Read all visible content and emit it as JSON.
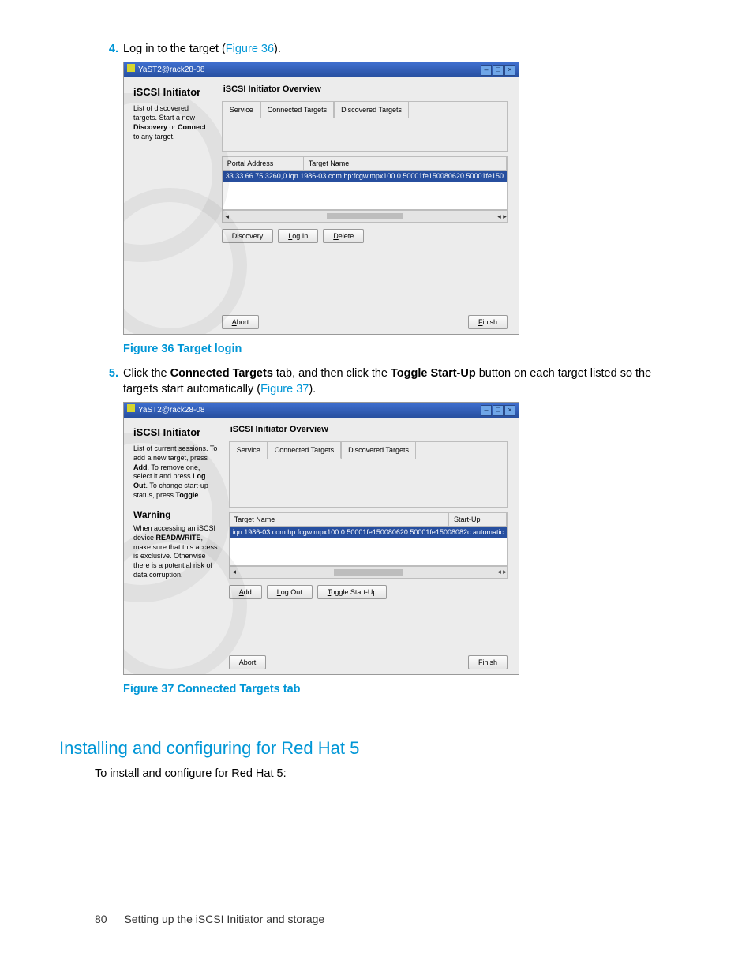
{
  "steps": {
    "s4": {
      "num": "4.",
      "text_a": "Log in to the target (",
      "link": "Figure 36",
      "text_b": ")."
    },
    "s5": {
      "num": "5.",
      "text_a": "Click the ",
      "bold1": "Connected Targets",
      "text_b": " tab, and then click the ",
      "bold2": "Toggle Start-Up",
      "text_c": " button on each target listed so the targets start automatically (",
      "link": "Figure 37",
      "text_d": ")."
    }
  },
  "figs": {
    "f36": "Figure 36 Target login",
    "f37": "Figure 37 Connected Targets tab"
  },
  "section": {
    "heading": "Installing and configuring for Red Hat 5",
    "intro": "To install and configure for Red Hat 5:"
  },
  "footer": {
    "page": "80",
    "chapter": "Setting up the iSCSI Initiator and storage"
  },
  "win1": {
    "title": "YaST2@rack28-08",
    "left_title": "iSCSI Initiator",
    "left_p1a": "List of discovered targets. Start a new ",
    "left_p1_b1": "Discovery",
    "left_p1b": " or ",
    "left_p1_b2": "Connect",
    "left_p1c": " to any target.",
    "right_title": "iSCSI Initiator Overview",
    "tabs": {
      "service": "Service",
      "connected": "Connected Targets",
      "discovered": "Discovered Targets"
    },
    "cols": {
      "portal": "Portal Address",
      "target": "Target Name"
    },
    "row": "33.33.66.75:3260,0 iqn.1986-03.com.hp:fcgw.mpx100.0.50001fe150080620.50001fe150",
    "btns": {
      "discovery": "Discovery",
      "login": "Log In",
      "delete": "Delete",
      "abort": "Abort",
      "finish": "Finish"
    },
    "underline": {
      "login": "L",
      "delete": "D",
      "abort": "A",
      "finish": "F"
    }
  },
  "win2": {
    "title": "YaST2@rack28-08",
    "left_title": "iSCSI Initiator",
    "left_p1a": "List of current sessions. To add a new target, press ",
    "b_add": "Add",
    "left_p1b": ". To remove one, select it and press ",
    "b_logout": "Log Out",
    "left_p1c": ". To change start-up status, press ",
    "b_toggle": "Toggle",
    "left_p1d": ".",
    "warn_h": "Warning",
    "warn_a": "When accessing an iSCSI device ",
    "warn_b": "READ/WRITE",
    "warn_c": ", make sure that this access is exclusive. Otherwise there is a potential risk of data corruption.",
    "right_title": "iSCSI Initiator Overview",
    "tabs": {
      "service": "Service",
      "connected": "Connected Targets",
      "discovered": "Discovered Targets"
    },
    "cols": {
      "target": "Target Name",
      "startup": "Start-Up"
    },
    "row": "iqn.1986-03.com.hp:fcgw.mpx100.0.50001fe150080620.50001fe15008082c automatic",
    "btns": {
      "add": "Add",
      "logout": "Log Out",
      "toggle": "Toggle Start-Up",
      "abort": "Abort",
      "finish": "Finish"
    },
    "underline": {
      "add": "A",
      "logout": "L",
      "toggle": "T",
      "abort": "A",
      "finish": "F"
    }
  }
}
